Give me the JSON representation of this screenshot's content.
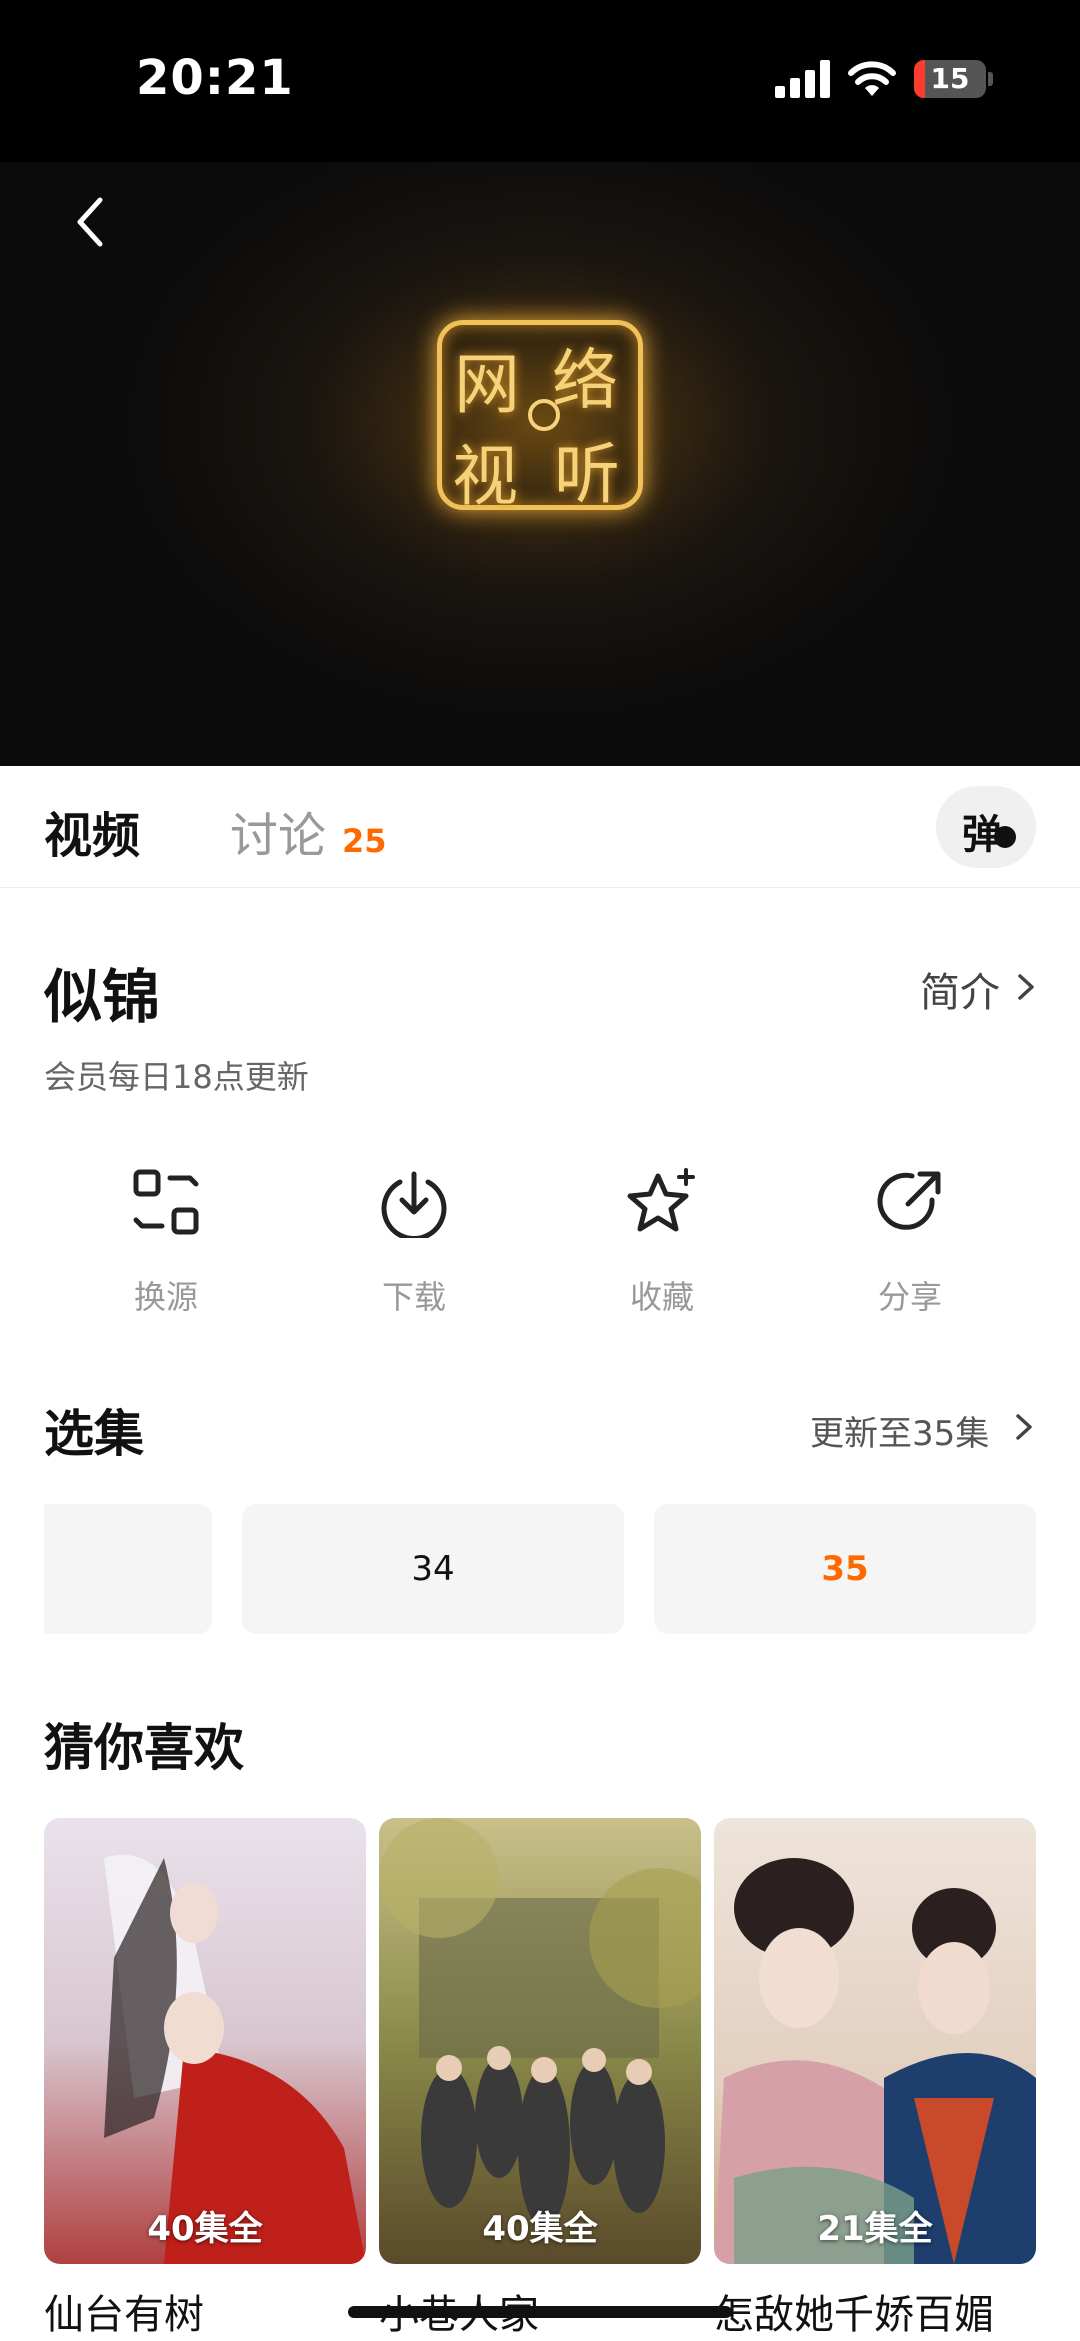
{
  "status": {
    "time": "20:21",
    "battery": "15",
    "battery_level": 0.15
  },
  "video": {
    "logo_chars": [
      "网",
      "络",
      "视",
      "听"
    ]
  },
  "tabs": {
    "video": "视频",
    "discuss": "讨论",
    "discuss_count": "25",
    "danmaku": "弹"
  },
  "show": {
    "title": "似锦",
    "intro": "简介",
    "update_note": "会员每日18点更新"
  },
  "actions": [
    {
      "label": "换源",
      "icon": "switch-source-icon"
    },
    {
      "label": "下载",
      "icon": "download-icon"
    },
    {
      "label": "收藏",
      "icon": "favorite-star-icon"
    },
    {
      "label": "分享",
      "icon": "share-icon"
    }
  ],
  "episodes": {
    "title": "选集",
    "more": "更新至35集",
    "items": [
      "",
      "34",
      "35"
    ],
    "active_color": "#ff6a00"
  },
  "recs": {
    "title": "猜你喜欢",
    "items": [
      {
        "name": "仙台有树",
        "badge": "40集全"
      },
      {
        "name": "小巷人家",
        "badge": "40集全"
      },
      {
        "name": "怎敌她千娇百媚",
        "badge": "21集全"
      }
    ]
  },
  "colors": {
    "accent": "#ff6a00",
    "text": "#111111",
    "muted": "#999999"
  }
}
